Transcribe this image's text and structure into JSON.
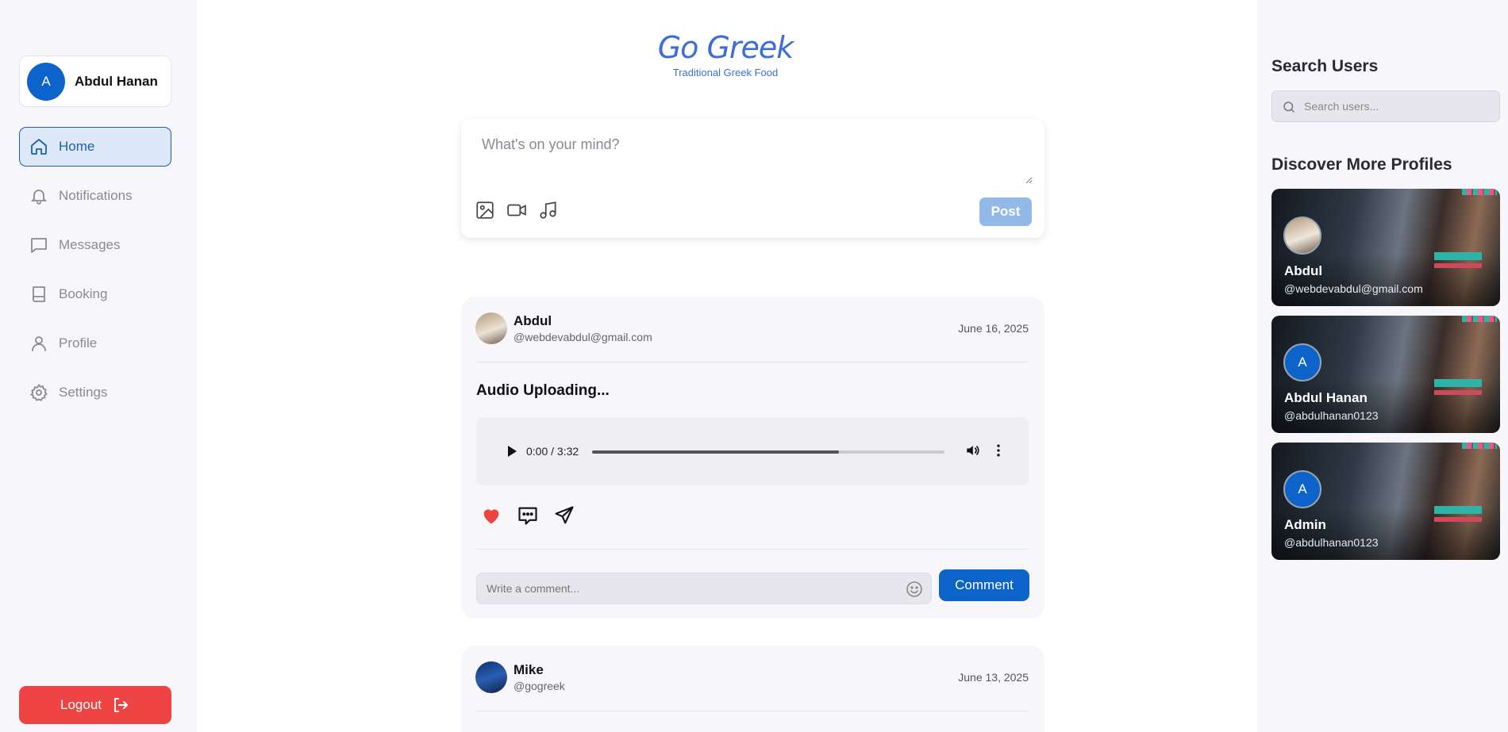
{
  "sidebar": {
    "user": {
      "initial": "A",
      "name": "Abdul Hanan"
    },
    "nav": [
      {
        "label": "Home",
        "icon": "home-icon",
        "active": true
      },
      {
        "label": "Notifications",
        "icon": "bell-icon"
      },
      {
        "label": "Messages",
        "icon": "message-icon"
      },
      {
        "label": "Booking",
        "icon": "book-icon"
      },
      {
        "label": "Profile",
        "icon": "user-icon"
      },
      {
        "label": "Settings",
        "icon": "gear-icon"
      }
    ],
    "logout_label": "Logout"
  },
  "brand": {
    "title": "Go Greek",
    "subtitle": "Traditional Greek Food",
    "color": "#3b6fd6"
  },
  "composer": {
    "placeholder": "What's on your mind?",
    "post_label": "Post"
  },
  "posts": [
    {
      "name": "Abdul",
      "handle": "@webdevabdul@gmail.com",
      "date": "June 16, 2025",
      "text": "Audio Uploading...",
      "audio": {
        "time": "0:00 / 3:32",
        "progress": 0.7
      },
      "comment_placeholder": "Write a comment...",
      "comment_label": "Comment"
    },
    {
      "name": "Mike",
      "handle": "@gogreek",
      "date": "June 13, 2025"
    }
  ],
  "right": {
    "search_title": "Search Users",
    "search_placeholder": "Search users...",
    "discover_title": "Discover More Profiles",
    "profiles": [
      {
        "name": "Abdul",
        "handle": "@webdevabdul@gmail.com"
      },
      {
        "initial": "A",
        "name": "Abdul Hanan",
        "handle": "@abdulhanan0123"
      },
      {
        "initial": "A",
        "name": "Admin",
        "handle": "@abdulhanan0123"
      }
    ]
  },
  "colors": {
    "accent": "#0c63c9",
    "logout": "#ef4444",
    "like": "#ef4444"
  }
}
